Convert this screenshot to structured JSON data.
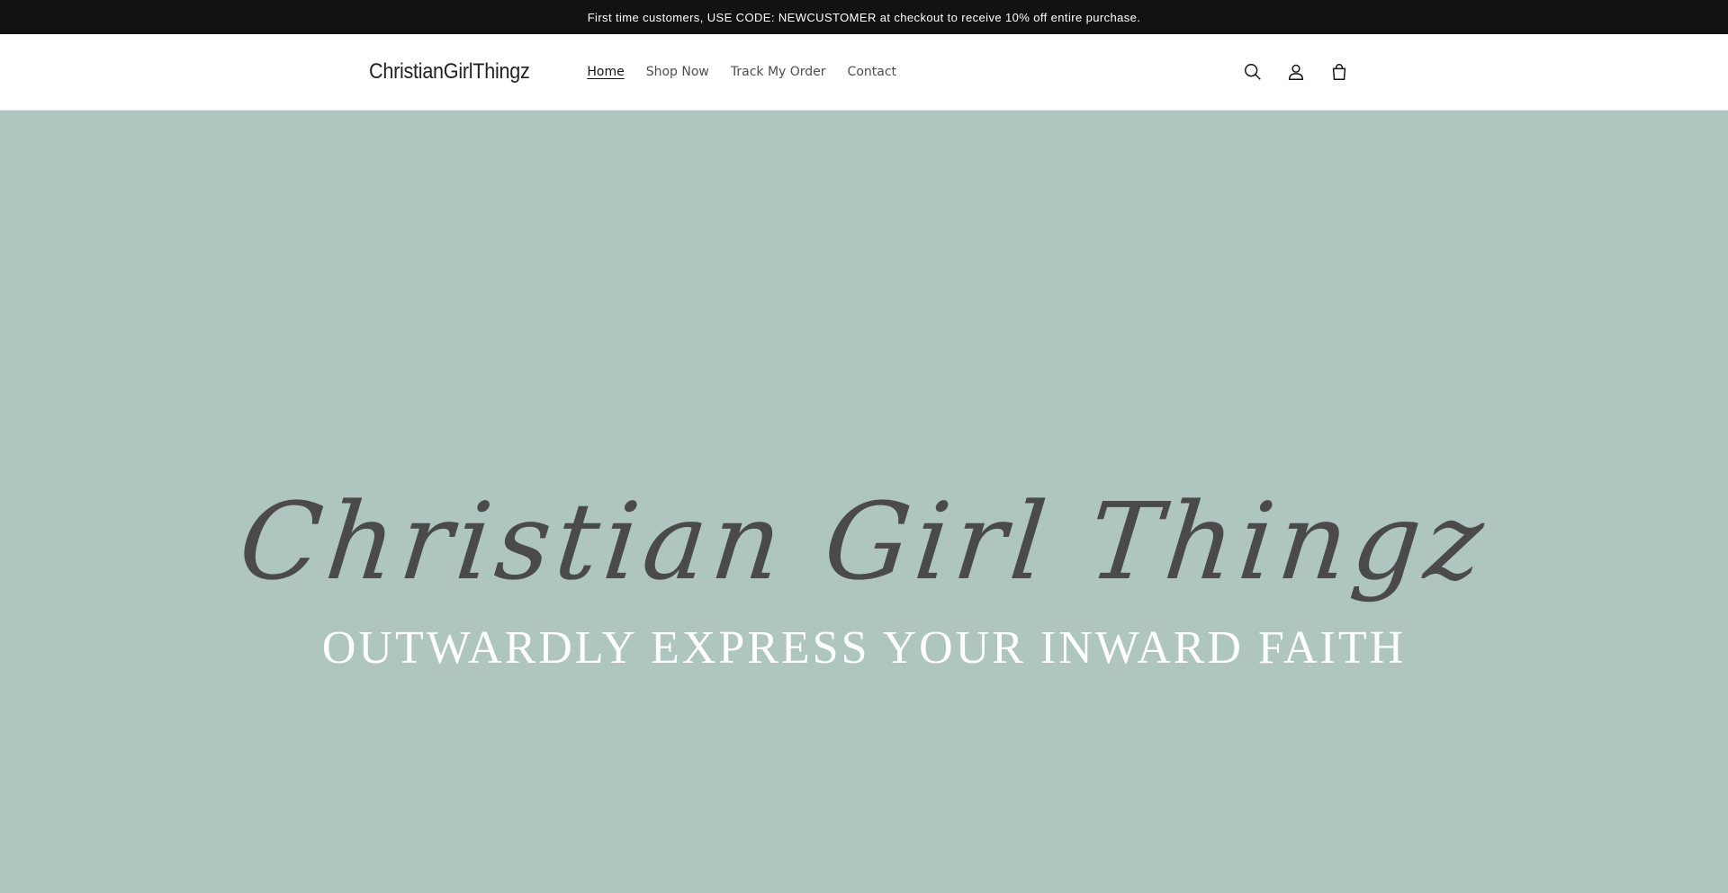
{
  "announcement": {
    "text": "First time customers, USE CODE: NEWCUSTOMER at checkout to receive 10% off entire purchase."
  },
  "header": {
    "logo": "ChristianGirlThingz",
    "nav": [
      {
        "label": "Home",
        "active": true
      },
      {
        "label": "Shop Now",
        "active": false
      },
      {
        "label": "Track My Order",
        "active": false
      },
      {
        "label": "Contact",
        "active": false
      }
    ],
    "icons": [
      "search-icon",
      "account-icon",
      "cart-icon"
    ]
  },
  "hero": {
    "background": "#afc5bf",
    "script_text": "Christian Girl Thingz",
    "tagline": "OUTWARDLY EXPRESS YOUR INWARD FAITH"
  }
}
